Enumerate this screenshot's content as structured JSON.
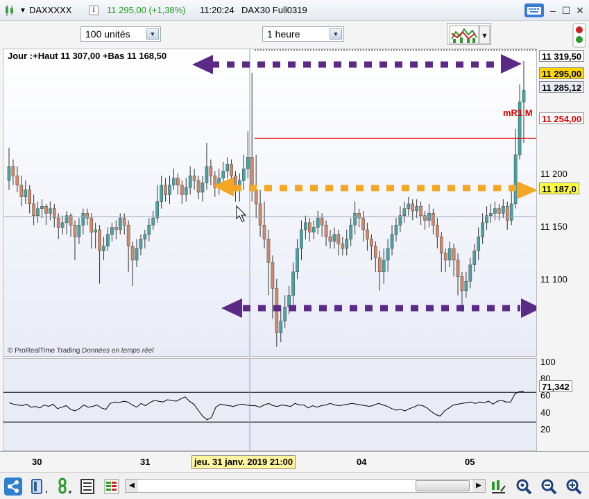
{
  "titlebar": {
    "symbol": "DAXXXXX",
    "price_change": "11 295,00 (+1,38%)",
    "time": "11:20:24",
    "instrument": "DAX30 Full0319"
  },
  "toolbar": {
    "units_select": "100 unités",
    "period_select": "1 heure"
  },
  "chart": {
    "header": "Jour :+Haut 11 307,00 +Bas 11 168,50",
    "copyright_brand": "© ProRealTime Trading",
    "copyright_status": "Données en temps réel",
    "indicator_label": "mR1 M"
  },
  "price_axis": {
    "ticks": [
      "11 200",
      "11 150",
      "11 100"
    ],
    "box_high": "11 319,50",
    "box_last": "11 295,00",
    "box_current": "11 285,12",
    "box_indicator": "11 254,00",
    "box_cursor": "11 187,0"
  },
  "rsi_axis": {
    "ticks": [
      "100",
      "80",
      "60",
      "40",
      "20"
    ],
    "value": "71,342"
  },
  "time_axis": {
    "labels": [
      "30",
      "31",
      "04",
      "05"
    ],
    "cursor_date": "jeu. 31 janv. 2019 21:00"
  },
  "colors": {
    "bull": "#4aa3a3",
    "bear": "#d08a6a",
    "arrow_purple": "#5b2a86",
    "arrow_orange": "#f5a623",
    "indicator_red": "#e00000"
  },
  "chart_data": {
    "type": "candlestick",
    "ylim": [
      11067,
      11330
    ],
    "levels": {
      "mR1": 11254.0,
      "cursor": 11187.0,
      "last": 11295.0,
      "current": 11285.12,
      "high": 11319.5
    },
    "candles": [
      [
        11218,
        11230,
        11246,
        11210
      ],
      [
        11230,
        11222,
        11236,
        11214
      ],
      [
        11222,
        11214,
        11230,
        11208
      ],
      [
        11214,
        11204,
        11222,
        11196
      ],
      [
        11204,
        11210,
        11218,
        11198
      ],
      [
        11210,
        11198,
        11214,
        11190
      ],
      [
        11198,
        11188,
        11206,
        11180
      ],
      [
        11188,
        11194,
        11200,
        11182
      ],
      [
        11194,
        11196,
        11202,
        11186
      ],
      [
        11196,
        11190,
        11198,
        11180
      ],
      [
        11190,
        11194,
        11200,
        11184
      ],
      [
        11194,
        11186,
        11198,
        11178
      ],
      [
        11186,
        11178,
        11190,
        11168
      ],
      [
        11178,
        11182,
        11188,
        11172
      ],
      [
        11182,
        11188,
        11192,
        11172
      ],
      [
        11188,
        11180,
        11190,
        11170
      ],
      [
        11180,
        11170,
        11184,
        11150
      ],
      [
        11170,
        11180,
        11186,
        11164
      ],
      [
        11180,
        11190,
        11194,
        11172
      ],
      [
        11190,
        11186,
        11194,
        11180
      ],
      [
        11186,
        11174,
        11190,
        11160
      ],
      [
        11174,
        11176,
        11182,
        11160
      ],
      [
        11176,
        11158,
        11180,
        11130
      ],
      [
        11158,
        11162,
        11170,
        11150
      ],
      [
        11162,
        11172,
        11178,
        11158
      ],
      [
        11172,
        11178,
        11182,
        11166
      ],
      [
        11178,
        11176,
        11184,
        11168
      ],
      [
        11176,
        11186,
        11190,
        11172
      ],
      [
        11186,
        11180,
        11190,
        11172
      ],
      [
        11180,
        11162,
        11184,
        11140
      ],
      [
        11162,
        11150,
        11166,
        11128
      ],
      [
        11150,
        11160,
        11168,
        11144
      ],
      [
        11160,
        11168,
        11172,
        11154
      ],
      [
        11168,
        11172,
        11176,
        11160
      ],
      [
        11172,
        11180,
        11186,
        11166
      ],
      [
        11180,
        11186,
        11192,
        11176
      ],
      [
        11186,
        11200,
        11214,
        11182
      ],
      [
        11200,
        11214,
        11222,
        11194
      ],
      [
        11214,
        11206,
        11220,
        11200
      ],
      [
        11206,
        11214,
        11222,
        11198
      ],
      [
        11214,
        11220,
        11228,
        11210
      ],
      [
        11220,
        11214,
        11224,
        11206
      ],
      [
        11214,
        11206,
        11218,
        11198
      ],
      [
        11206,
        11212,
        11220,
        11200
      ],
      [
        11212,
        11222,
        11230,
        11206
      ],
      [
        11222,
        11218,
        11228,
        11210
      ],
      [
        11218,
        11208,
        11222,
        11202
      ],
      [
        11208,
        11216,
        11222,
        11200
      ],
      [
        11216,
        11230,
        11250,
        11210
      ],
      [
        11230,
        11222,
        11236,
        11214
      ],
      [
        11222,
        11212,
        11226,
        11204
      ],
      [
        11212,
        11220,
        11228,
        11206
      ],
      [
        11220,
        11226,
        11234,
        11216
      ],
      [
        11226,
        11232,
        11238,
        11220
      ],
      [
        11232,
        11222,
        11236,
        11210
      ],
      [
        11222,
        11212,
        11226,
        11200
      ],
      [
        11212,
        11218,
        11224,
        11200
      ],
      [
        11218,
        11228,
        11240,
        11210
      ],
      [
        11228,
        11238,
        11260,
        11220
      ],
      [
        11238,
        11210,
        11310,
        11200
      ],
      [
        11210,
        11198,
        11240,
        11186
      ],
      [
        11198,
        11180,
        11210,
        11170
      ],
      [
        11180,
        11168,
        11200,
        11160
      ],
      [
        11168,
        11148,
        11176,
        11120
      ],
      [
        11148,
        11126,
        11154,
        11100
      ],
      [
        11126,
        11088,
        11134,
        11076
      ],
      [
        11088,
        11098,
        11110,
        11080
      ],
      [
        11098,
        11110,
        11120,
        11092
      ],
      [
        11110,
        11120,
        11128,
        11104
      ],
      [
        11120,
        11140,
        11148,
        11112
      ],
      [
        11140,
        11160,
        11168,
        11134
      ],
      [
        11160,
        11176,
        11184,
        11150
      ],
      [
        11176,
        11182,
        11188,
        11168
      ],
      [
        11182,
        11174,
        11186,
        11166
      ],
      [
        11174,
        11178,
        11184,
        11168
      ],
      [
        11178,
        11186,
        11192,
        11172
      ],
      [
        11186,
        11180,
        11190,
        11170
      ],
      [
        11180,
        11170,
        11184,
        11162
      ],
      [
        11170,
        11166,
        11176,
        11160
      ],
      [
        11166,
        11172,
        11178,
        11160
      ],
      [
        11172,
        11164,
        11176,
        11154
      ],
      [
        11164,
        11160,
        11170,
        11154
      ],
      [
        11160,
        11168,
        11176,
        11154
      ],
      [
        11168,
        11180,
        11186,
        11162
      ],
      [
        11180,
        11190,
        11200,
        11172
      ],
      [
        11190,
        11186,
        11194,
        11178
      ],
      [
        11186,
        11176,
        11192,
        11166
      ],
      [
        11176,
        11168,
        11182,
        11158
      ],
      [
        11168,
        11162,
        11172,
        11150
      ],
      [
        11162,
        11152,
        11166,
        11140
      ],
      [
        11152,
        11140,
        11158,
        11124
      ],
      [
        11140,
        11150,
        11160,
        11130
      ],
      [
        11150,
        11160,
        11168,
        11140
      ],
      [
        11160,
        11172,
        11180,
        11154
      ],
      [
        11172,
        11180,
        11186,
        11166
      ],
      [
        11180,
        11188,
        11196,
        11174
      ],
      [
        11188,
        11194,
        11200,
        11182
      ],
      [
        11194,
        11198,
        11204,
        11188
      ],
      [
        11198,
        11192,
        11202,
        11184
      ],
      [
        11192,
        11196,
        11202,
        11186
      ],
      [
        11196,
        11188,
        11200,
        11180
      ],
      [
        11188,
        11184,
        11192,
        11176
      ],
      [
        11184,
        11190,
        11198,
        11178
      ],
      [
        11190,
        11180,
        11194,
        11172
      ],
      [
        11180,
        11170,
        11186,
        11160
      ],
      [
        11170,
        11156,
        11174,
        11140
      ],
      [
        11156,
        11150,
        11160,
        11140
      ],
      [
        11150,
        11160,
        11166,
        11144
      ],
      [
        11160,
        11150,
        11164,
        11136
      ],
      [
        11150,
        11136,
        11156,
        11120
      ],
      [
        11136,
        11124,
        11140,
        11106
      ],
      [
        11124,
        11132,
        11140,
        11118
      ],
      [
        11132,
        11146,
        11152,
        11126
      ],
      [
        11146,
        11158,
        11164,
        11140
      ],
      [
        11158,
        11170,
        11178,
        11150
      ],
      [
        11170,
        11182,
        11190,
        11164
      ],
      [
        11182,
        11188,
        11196,
        11176
      ],
      [
        11188,
        11190,
        11198,
        11182
      ],
      [
        11190,
        11194,
        11200,
        11184
      ],
      [
        11194,
        11190,
        11198,
        11184
      ],
      [
        11190,
        11196,
        11202,
        11186
      ],
      [
        11196,
        11184,
        11200,
        11176
      ],
      [
        11184,
        11198,
        11210,
        11180
      ],
      [
        11198,
        11240,
        11262,
        11194
      ],
      [
        11240,
        11285,
        11300,
        11236
      ],
      [
        11285,
        11295,
        11320,
        11250
      ]
    ],
    "rsi_ylim": [
      0,
      100
    ],
    "rsi_levels": [
      70,
      30
    ],
    "rsi": [
      56,
      54,
      53,
      52,
      54,
      50,
      51,
      49,
      53,
      51,
      54,
      48,
      50,
      52,
      47,
      45,
      48,
      53,
      50,
      51,
      53,
      49,
      47,
      55,
      57,
      56,
      58,
      57,
      53,
      50,
      55,
      52,
      56,
      59,
      58,
      57,
      60,
      59,
      58,
      61,
      64,
      58,
      54,
      46,
      38,
      33,
      36,
      50,
      54,
      53,
      52,
      51,
      53,
      54,
      53,
      52,
      52,
      50,
      53,
      55,
      52,
      51,
      53,
      52,
      51,
      55,
      53,
      53,
      49,
      52,
      50,
      52,
      53,
      55,
      53,
      52,
      53,
      54,
      55,
      54,
      53,
      52,
      51,
      53,
      55,
      53,
      51,
      48,
      46,
      47,
      45,
      48,
      50,
      53,
      52,
      49,
      44,
      40,
      38,
      45,
      49,
      53,
      54,
      55,
      56,
      57,
      55,
      57,
      56,
      58,
      54,
      58,
      59,
      57,
      57,
      68,
      71,
      71.3
    ]
  }
}
